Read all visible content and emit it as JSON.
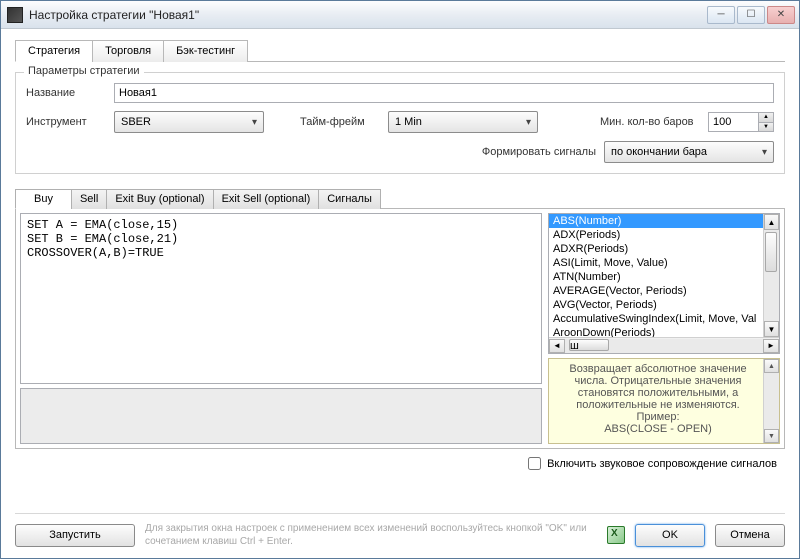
{
  "window": {
    "title": "Настройка стратегии \"Новая1\""
  },
  "tabs": {
    "strategy": "Стратегия",
    "trading": "Торговля",
    "backtest": "Бэк-тестинг"
  },
  "params": {
    "legend": "Параметры стратегии",
    "name_label": "Название",
    "name_value": "Новая1",
    "instrument_label": "Инструмент",
    "instrument_value": "SBER",
    "timeframe_label": "Тайм-фрейм",
    "timeframe_value": "1 Min",
    "minbars_label": "Мин. кол-во баров",
    "minbars_value": "100",
    "signalform_label": "Формировать сигналы",
    "signalform_value": "по окончании бара"
  },
  "inner_tabs": {
    "buy": "Buy",
    "sell": "Sell",
    "exit_buy": "Exit Buy (optional)",
    "exit_sell": "Exit Sell (optional)",
    "signals": "Сигналы"
  },
  "code": "SET A = EMA(close,15)\nSET B = EMA(close,21)\nCROSSOVER(A,B)=TRUE",
  "functions": [
    "ABS(Number)",
    "ADX(Periods)",
    "ADXR(Periods)",
    "ASI(Limit, Move, Value)",
    "ATN(Number)",
    "AVERAGE(Vector, Periods)",
    "AVG(Vector, Periods)",
    "AccumulativeSwingIndex(Limit, Move, Val",
    "AroonDown(Periods)"
  ],
  "help_text": "Возвращает абсолютное значение числа. Отрицательные значения становятся положительными, а положительные не изменяются.\nПример:\nABS(CLOSE - OPEN)",
  "sound_checkbox_label": "Включить звуковое сопровождение сигналов",
  "bottom": {
    "run": "Запустить",
    "hint": "Для закрытия окна настроек с применением всех изменений воспользуйтесь кнопкой \"OK\" или сочетанием клавиш Ctrl + Enter.",
    "ok": "OK",
    "cancel": "Отмена"
  },
  "hscroll_thumb_label": "ш"
}
